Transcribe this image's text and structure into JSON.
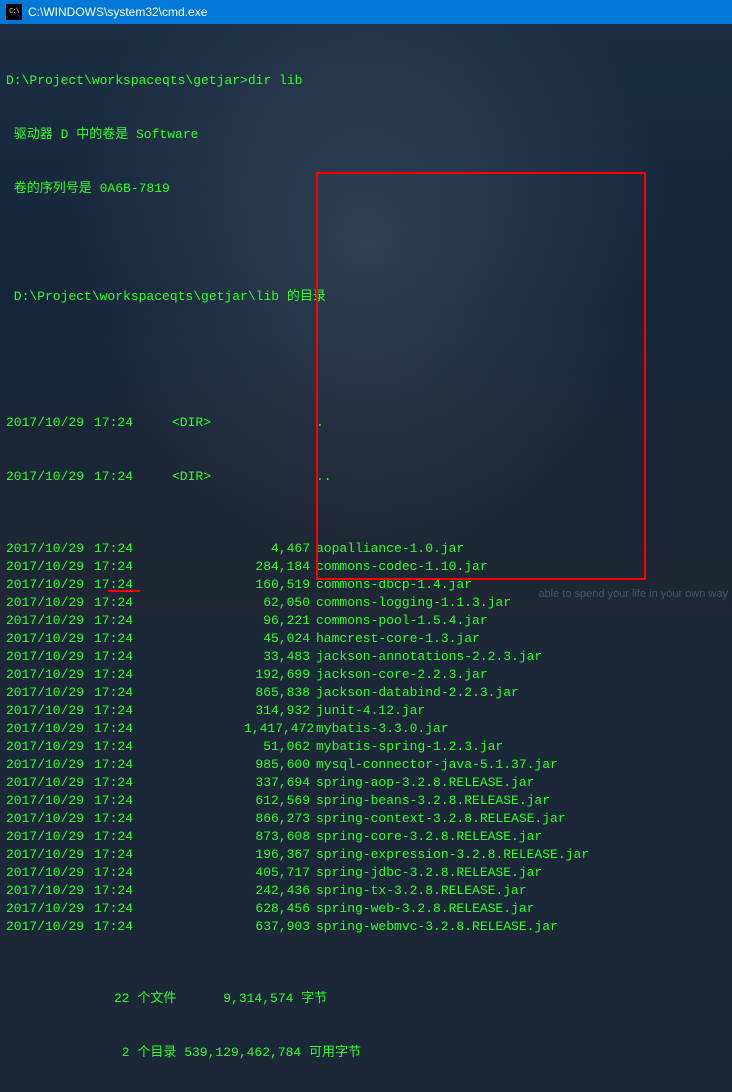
{
  "titlebar": {
    "text": "C:\\WINDOWS\\system32\\cmd.exe"
  },
  "prompt": "D:\\Project\\workspaceqts\\getjar>dir lib",
  "volume_line": " 驱动器 D 中的卷是 Software",
  "serial_line": " 卷的序列号是 0A6B-7819",
  "dir_header": " D:\\Project\\workspaceqts\\getjar\\lib 的目录",
  "dir_label": "<DIR>",
  "dot": ".",
  "dotdot": "..",
  "dirs_meta": [
    {
      "date": "2017/10/29",
      "time": "17:24"
    },
    {
      "date": "2017/10/29",
      "time": "17:24"
    }
  ],
  "files": [
    {
      "date": "2017/10/29",
      "time": "17:24",
      "size": "4,467",
      "name": "aopalliance-1.0.jar"
    },
    {
      "date": "2017/10/29",
      "time": "17:24",
      "size": "284,184",
      "name": "commons-codec-1.10.jar"
    },
    {
      "date": "2017/10/29",
      "time": "17:24",
      "size": "160,519",
      "name": "commons-dbcp-1.4.jar"
    },
    {
      "date": "2017/10/29",
      "time": "17:24",
      "size": "62,050",
      "name": "commons-logging-1.1.3.jar"
    },
    {
      "date": "2017/10/29",
      "time": "17:24",
      "size": "96,221",
      "name": "commons-pool-1.5.4.jar"
    },
    {
      "date": "2017/10/29",
      "time": "17:24",
      "size": "45,024",
      "name": "hamcrest-core-1.3.jar"
    },
    {
      "date": "2017/10/29",
      "time": "17:24",
      "size": "33,483",
      "name": "jackson-annotations-2.2.3.jar"
    },
    {
      "date": "2017/10/29",
      "time": "17:24",
      "size": "192,699",
      "name": "jackson-core-2.2.3.jar"
    },
    {
      "date": "2017/10/29",
      "time": "17:24",
      "size": "865,838",
      "name": "jackson-databind-2.2.3.jar"
    },
    {
      "date": "2017/10/29",
      "time": "17:24",
      "size": "314,932",
      "name": "junit-4.12.jar"
    },
    {
      "date": "2017/10/29",
      "time": "17:24",
      "size": "1,417,472",
      "name": "mybatis-3.3.0.jar"
    },
    {
      "date": "2017/10/29",
      "time": "17:24",
      "size": "51,062",
      "name": "mybatis-spring-1.2.3.jar"
    },
    {
      "date": "2017/10/29",
      "time": "17:24",
      "size": "985,600",
      "name": "mysql-connector-java-5.1.37.jar"
    },
    {
      "date": "2017/10/29",
      "time": "17:24",
      "size": "337,694",
      "name": "spring-aop-3.2.8.RELEASE.jar"
    },
    {
      "date": "2017/10/29",
      "time": "17:24",
      "size": "612,569",
      "name": "spring-beans-3.2.8.RELEASE.jar"
    },
    {
      "date": "2017/10/29",
      "time": "17:24",
      "size": "866,273",
      "name": "spring-context-3.2.8.RELEASE.jar"
    },
    {
      "date": "2017/10/29",
      "time": "17:24",
      "size": "873,608",
      "name": "spring-core-3.2.8.RELEASE.jar"
    },
    {
      "date": "2017/10/29",
      "time": "17:24",
      "size": "196,367",
      "name": "spring-expression-3.2.8.RELEASE.jar"
    },
    {
      "date": "2017/10/29",
      "time": "17:24",
      "size": "405,717",
      "name": "spring-jdbc-3.2.8.RELEASE.jar"
    },
    {
      "date": "2017/10/29",
      "time": "17:24",
      "size": "242,436",
      "name": "spring-tx-3.2.8.RELEASE.jar"
    },
    {
      "date": "2017/10/29",
      "time": "17:24",
      "size": "628,456",
      "name": "spring-web-3.2.8.RELEASE.jar"
    },
    {
      "date": "2017/10/29",
      "time": "17:24",
      "size": "637,903",
      "name": "spring-webmvc-3.2.8.RELEASE.jar"
    }
  ],
  "summary_files": "22 个文件      9,314,574 字节",
  "summary_dirs": " 2 个目录 539,129,462,784 可用字节",
  "watermark": "able to spend your life in your own way"
}
